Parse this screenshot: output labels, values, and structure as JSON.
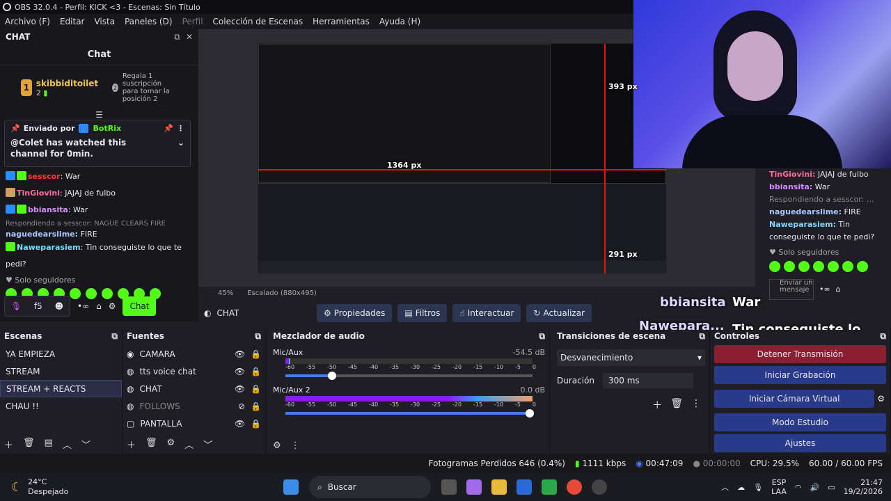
{
  "window": {
    "title": "OBS 32.0.4 - Perfil: KICK <3 - Escenas: Sin Título"
  },
  "menu": [
    "Archivo (F)",
    "Editar",
    "Vista",
    "Paneles (D)",
    "Perfil",
    "Colección de Escenas",
    "Herramientas",
    "Ayuda (H)"
  ],
  "chat_dock": {
    "dock_title": "CHAT",
    "title": "Chat",
    "leader": {
      "rank": "1",
      "name": "skibbiditoilet",
      "count": "2",
      "gift_rank": "2",
      "gift_text": "Regala 1 suscripción para tomar la posición 2"
    },
    "pinned": {
      "label": "Enviado por",
      "bot": "BotRix",
      "message": "@Colet has watched this channel for 0min."
    },
    "messages": [
      {
        "user": "sesscor",
        "text": "War",
        "color": "#ff3a3a"
      },
      {
        "user": "TinGiovini",
        "text": "JAJAJ de fulbo",
        "color": "#ff6b9a"
      },
      {
        "user": "bbiansita",
        "text": "War",
        "color": "#d58cff"
      },
      {
        "user": "nagueDearslime",
        "text": "FIRE",
        "color": "#a8c8ff"
      },
      {
        "user": "Naweparasiem",
        "text": "Tin conseguiste lo que te pedi?",
        "color": "#7fd8ff"
      }
    ],
    "reply_note": "Respondiendo a sesscor: NAGUE CLEARS FIRE",
    "reply_user": "naguedearslime:",
    "reply_text": "FIRE",
    "followers_only": "Solo seguidores",
    "input_value": "f5",
    "send_label": "Chat"
  },
  "overlay": {
    "px_width": "1364 px",
    "px_top": "393 px",
    "px_bottom": "291 px",
    "overlay_user1": "bbiansita",
    "overlay_msg1": "War",
    "overlay_user2": "Nawepara...",
    "overlay_msg2": "Tin conseguiste lo que te pedi?",
    "right_msgs": [
      {
        "user": "TinGiovini:",
        "text": "JAJAJ de fulbo"
      },
      {
        "user": "bbiansita:",
        "text": "War"
      },
      {
        "user": "",
        "text": "Respondiendo a sesscor: ..."
      },
      {
        "user": "naguedearslime:",
        "text": "FIRE"
      },
      {
        "user": "Naweparasiem:",
        "text": "Tin conseguiste lo que te pedi?"
      }
    ],
    "right_followers": "Solo seguidores",
    "right_input_placeholder": "Enviar un mensaje"
  },
  "preview": {
    "zoom": "45%",
    "scale": "Escalado (880x495)"
  },
  "source_toolbar": {
    "source": "CHAT",
    "properties": "Propiedades",
    "filters": "Filtros",
    "interact": "Interactuar",
    "update": "Actualizar"
  },
  "scenes": {
    "title": "Escenas",
    "items": [
      "YA EMPIEZA",
      "STREAM",
      "STREAM + REACTS",
      "CHAU !!"
    ],
    "selected": 2
  },
  "sources": {
    "title": "Fuentes",
    "items": [
      "CAMARA",
      "tts voice chat",
      "CHAT",
      "FOLLOWS",
      "PANTALLA"
    ]
  },
  "mixer": {
    "title": "Mezclador de audio",
    "channels": [
      {
        "name": "Mic/Aux",
        "db": "-54.5 dB",
        "level": 0.02,
        "fader": 0.2
      },
      {
        "name": "Mic/Aux 2",
        "db": "0.0 dB",
        "level": 1.0,
        "fader": 1.0
      }
    ],
    "ticks": [
      "-60",
      "-55",
      "-50",
      "-45",
      "-40",
      "-35",
      "-30",
      "-25",
      "-20",
      "-15",
      "-10",
      "-5",
      "0"
    ]
  },
  "transitions": {
    "title": "Transiciones de escena",
    "type": "Desvanecimiento",
    "duration_label": "Duración",
    "duration": "300 ms"
  },
  "controls": {
    "title": "Controles",
    "buttons": [
      "Detener Transmisión",
      "Iniciar Grabación",
      "Iniciar Cámara Virtual",
      "Modo Estudio",
      "Ajustes"
    ]
  },
  "status": {
    "dropped": "Fotogramas Perdidos 646 (0.4%)",
    "kbps": "1111 kbps",
    "stream_time": "00:47:09",
    "rec_time": "00:00:00",
    "cpu": "CPU: 29.5%",
    "fps": "60.00 / 60.00 FPS"
  },
  "taskbar": {
    "temp": "24°C",
    "weather": "Despejado",
    "search": "Buscar",
    "lang1": "ESP",
    "lang2": "LAA",
    "time": "21:47",
    "date": "19/2/2026"
  }
}
